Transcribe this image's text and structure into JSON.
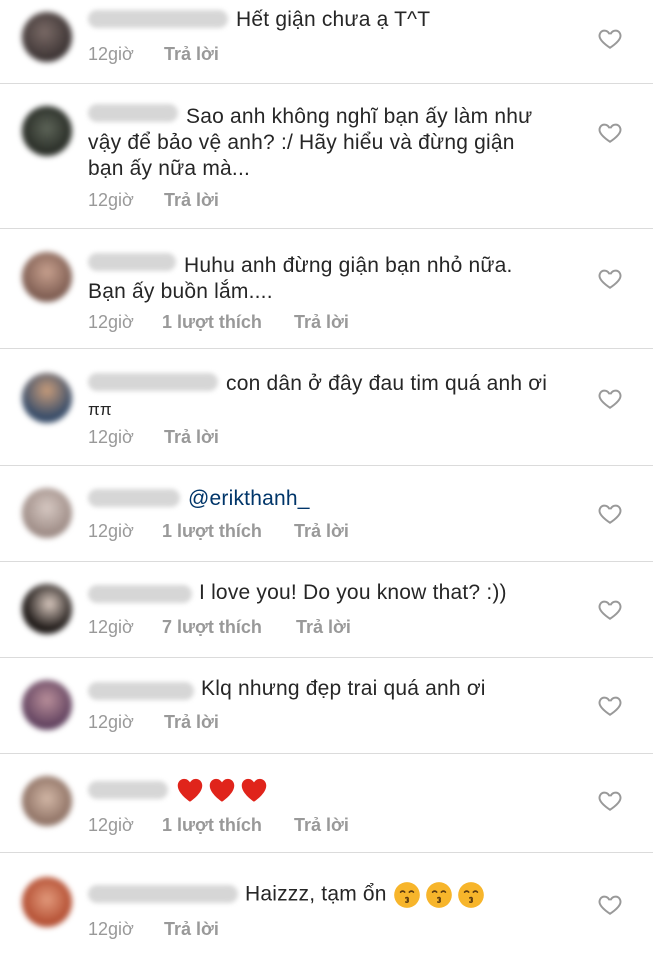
{
  "labels": {
    "reply": "Trả lời"
  },
  "comments": [
    {
      "text_lines": [
        "Hết giận chưa ạ T^T"
      ],
      "time": "12giờ",
      "likes": ""
    },
    {
      "text_lines": [
        "Sao anh không nghĩ bạn ấy làm như",
        "vậy để bảo vệ anh? :/ Hãy hiểu và đừng giận",
        "bạn ấy nữa mà..."
      ],
      "time": "12giờ",
      "likes": ""
    },
    {
      "text_lines": [
        "Huhu anh đừng giận bạn nhỏ nữa.",
        "Bạn ấy buồn lắm...."
      ],
      "time": "12giờ",
      "likes": "1 lượt thích"
    },
    {
      "text_lines": [
        "con dân ở đây đau tim quá anh ơi",
        "ππ"
      ],
      "time": "12giờ",
      "likes": ""
    },
    {
      "text_lines": [
        "@erikthanh_"
      ],
      "time": "12giờ",
      "likes": "1 lượt thích"
    },
    {
      "text_lines": [
        "I love you! Do you know that? :))"
      ],
      "time": "12giờ",
      "likes": "7 lượt thích"
    },
    {
      "text_lines": [
        "Klq nhưng đẹp trai quá anh ơi"
      ],
      "time": "12giờ",
      "likes": ""
    },
    {
      "text_lines": [
        ""
      ],
      "emoji": [
        "red-heart-emoji",
        "red-heart-emoji",
        "red-heart-emoji"
      ],
      "time": "12giờ",
      "likes": "1 lượt thích"
    },
    {
      "text_lines": [
        "Haizzz, tạm ổn"
      ],
      "emoji": [
        "kissing-face-emoji",
        "kissing-face-emoji",
        "kissing-face-emoji"
      ],
      "time": "12giờ",
      "likes": ""
    }
  ],
  "colors": {
    "text": "#262626",
    "meta": "#999999",
    "divider": "#dbdbdb",
    "mention": "#003569",
    "heart_emoji": "#e0241b",
    "kiss_emoji": "#f7b52b"
  }
}
